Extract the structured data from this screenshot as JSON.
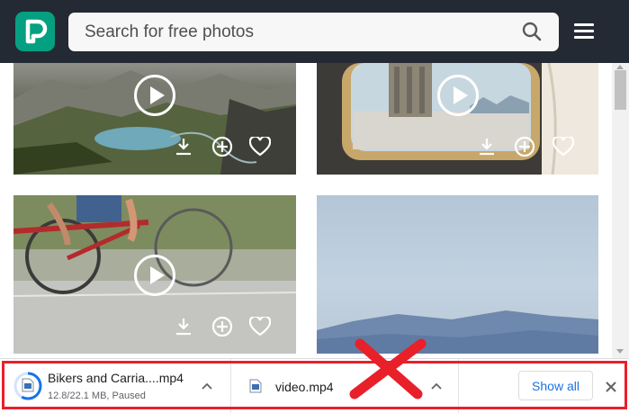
{
  "header": {
    "search_placeholder": "Search for free photos",
    "logo_letter": "P",
    "logo_color": "#05a081",
    "background_color": "#232a34"
  },
  "icons": {
    "logo": "pexels-logo-icon",
    "search": "search-icon",
    "menu": "hamburger-menu-icon",
    "play": "play-icon",
    "download": "download-icon",
    "add": "add-to-collection-icon",
    "like": "heart-icon",
    "video_file": "video-file-icon",
    "chevron": "chevron-up-icon",
    "close": "close-icon"
  },
  "grid": {
    "videos": [
      {
        "scene": "mountain lake valley",
        "has_play": true,
        "has_actions": true
      },
      {
        "scene": "train window city view",
        "has_play": true,
        "has_actions": true
      },
      {
        "scene": "bicycles on road",
        "has_play": true,
        "has_actions": true
      },
      {
        "scene": "blue sky over mountains",
        "has_play": false,
        "has_actions": false
      }
    ]
  },
  "downloads": {
    "items": [
      {
        "name": "Bikers and Carria....mp4",
        "status": "12.8/22.1 MB, Paused",
        "progress": 0.58
      },
      {
        "name": "video.mp4",
        "status": ""
      }
    ],
    "show_all_label": "Show all"
  },
  "colors": {
    "accent": "#1a73e8",
    "annotation": "#e8202a"
  }
}
